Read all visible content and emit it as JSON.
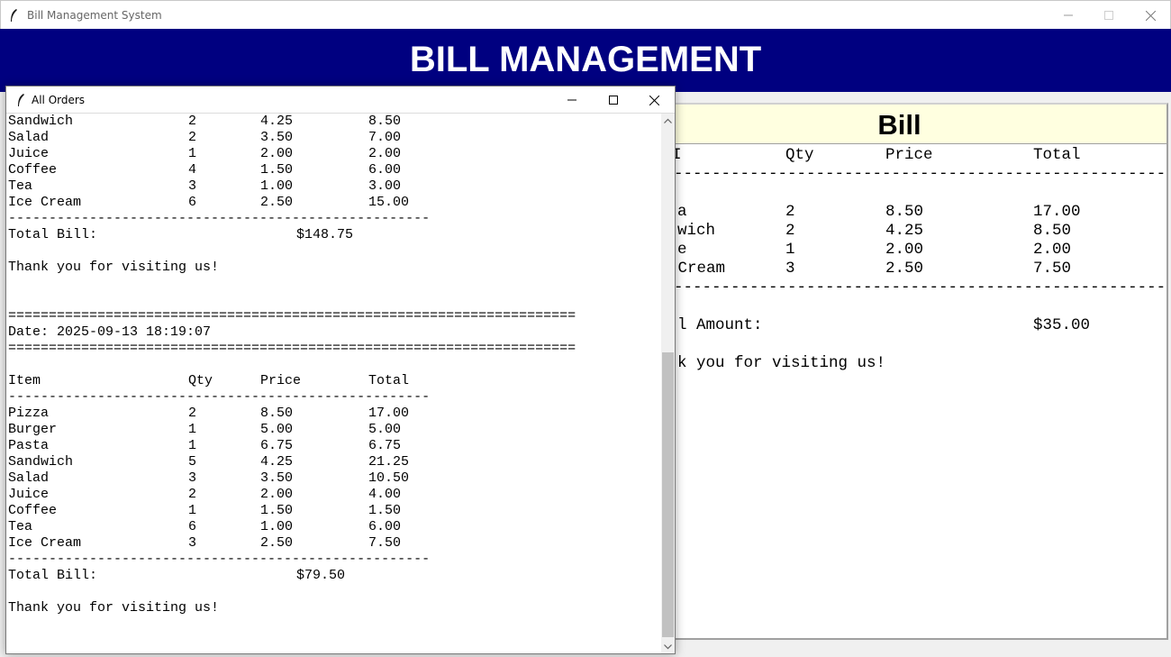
{
  "main_window": {
    "title": "Bill Management System",
    "heading": "BILL MANAGEMENT",
    "colors": {
      "header_bg": "#000080",
      "bill_band_bg": "#ffffe0"
    }
  },
  "bill": {
    "title": "Bill",
    "header": {
      "item": "I",
      "qty": "Qty",
      "price": "Price",
      "total": "Total"
    },
    "divider": "---------------------------------------------------------------",
    "rows": [
      {
        "item": "a",
        "qty": "2",
        "price": "8.50",
        "total": "17.00"
      },
      {
        "item": "wich",
        "qty": "2",
        "price": "4.25",
        "total": "8.50"
      },
      {
        "item": "e",
        "qty": "1",
        "price": "2.00",
        "total": "2.00"
      },
      {
        "item": " Cream",
        "qty": "3",
        "price": "2.50",
        "total": "7.50"
      }
    ],
    "total_label": "l Amount:",
    "total_value": "$35.00",
    "thanks": "k you for visiting us!"
  },
  "orders_window": {
    "title": "All Orders",
    "order1": {
      "rows": [
        {
          "item": "Sandwich",
          "qty": "2",
          "price": "4.25",
          "total": "8.50"
        },
        {
          "item": "Salad",
          "qty": "2",
          "price": "3.50",
          "total": "7.00"
        },
        {
          "item": "Juice",
          "qty": "1",
          "price": "2.00",
          "total": "2.00"
        },
        {
          "item": "Coffee",
          "qty": "4",
          "price": "1.50",
          "total": "6.00"
        },
        {
          "item": "Tea",
          "qty": "3",
          "price": "1.00",
          "total": "3.00"
        },
        {
          "item": "Ice Cream",
          "qty": "6",
          "price": "2.50",
          "total": "15.00"
        }
      ],
      "total_label": "Total Bill:",
      "total_value": "$148.75",
      "thanks": "Thank you for visiting us!"
    },
    "separator_eq": "======================================================================",
    "separator_dash": "----------------------------------------------------",
    "order2": {
      "date": "Date: 2025-09-13 18:19:07",
      "header": {
        "item": "Item",
        "qty": "Qty",
        "price": "Price",
        "total": "Total"
      },
      "rows": [
        {
          "item": "Pizza",
          "qty": "2",
          "price": "8.50",
          "total": "17.00"
        },
        {
          "item": "Burger",
          "qty": "1",
          "price": "5.00",
          "total": "5.00"
        },
        {
          "item": "Pasta",
          "qty": "1",
          "price": "6.75",
          "total": "6.75"
        },
        {
          "item": "Sandwich",
          "qty": "5",
          "price": "4.25",
          "total": "21.25"
        },
        {
          "item": "Salad",
          "qty": "3",
          "price": "3.50",
          "total": "10.50"
        },
        {
          "item": "Juice",
          "qty": "2",
          "price": "2.00",
          "total": "4.00"
        },
        {
          "item": "Coffee",
          "qty": "1",
          "price": "1.50",
          "total": "1.50"
        },
        {
          "item": "Tea",
          "qty": "6",
          "price": "1.00",
          "total": "6.00"
        },
        {
          "item": "Ice Cream",
          "qty": "3",
          "price": "2.50",
          "total": "7.50"
        }
      ],
      "total_label": "Total Bill:",
      "total_value": "$79.50",
      "thanks": "Thank you for visiting us!"
    }
  }
}
